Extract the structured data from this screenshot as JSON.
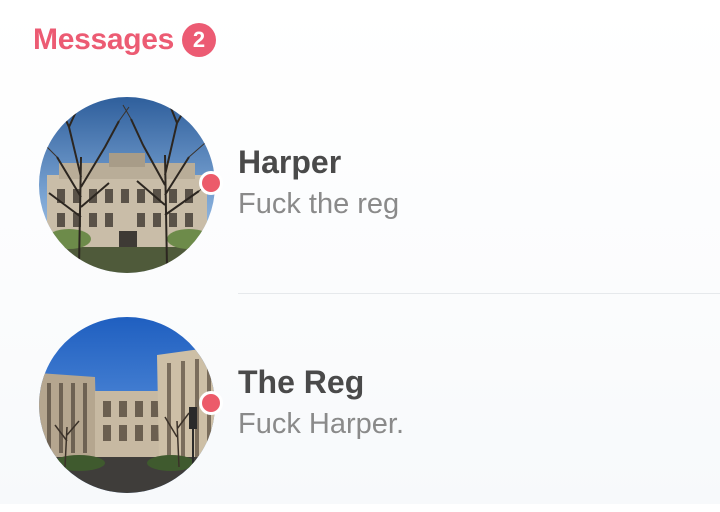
{
  "header": {
    "title": "Messages",
    "badge_count": "2"
  },
  "conversations": [
    {
      "name": "Harper",
      "preview": "Fuck the reg",
      "avatar_icon": "building-photo-winter-trees",
      "unread": true
    },
    {
      "name": "The Reg",
      "preview": "Fuck Harper.",
      "avatar_icon": "building-photo-courtyard",
      "unread": true
    }
  ],
  "colors": {
    "accent": "#ec5b73",
    "name_text": "#4a4a4a",
    "preview_text": "#8a8a8a"
  }
}
